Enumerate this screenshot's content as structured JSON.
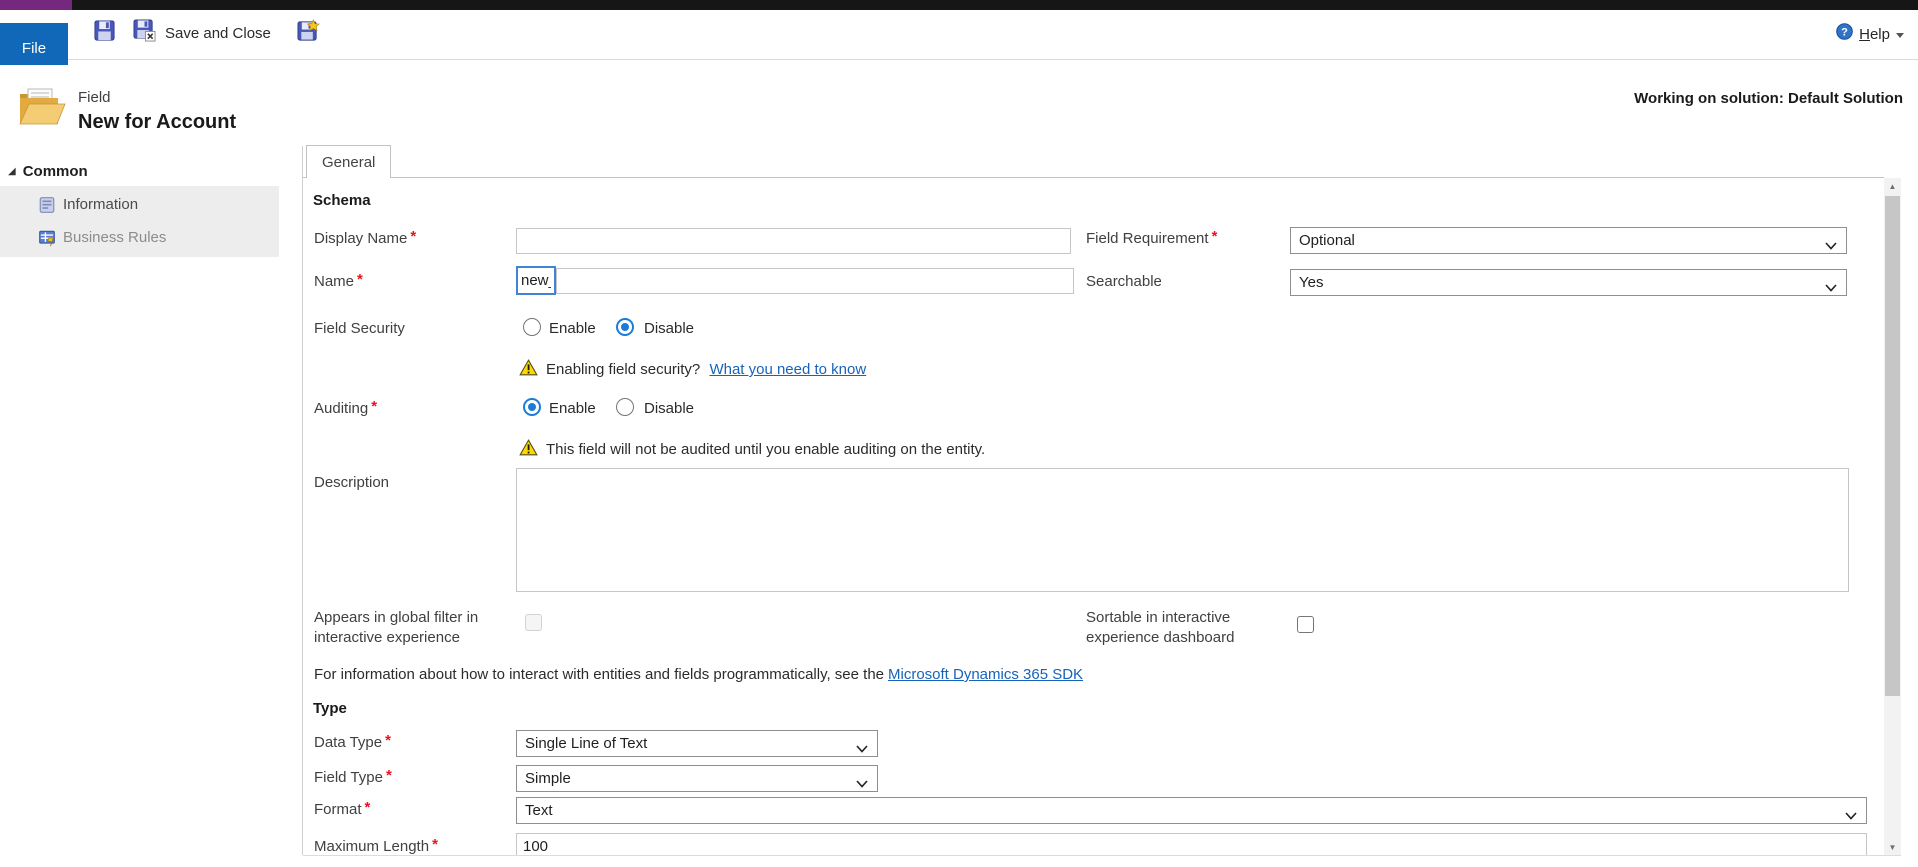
{
  "topbar": {
    "file_label": "File",
    "save_and_close_label": "Save and Close",
    "help_key": "H",
    "help_rest": "elp"
  },
  "header": {
    "record_type": "Field",
    "title": "New for Account",
    "solution_note": "Working on solution: Default Solution"
  },
  "sidebar": {
    "expander_glyph": "◢",
    "group_label": "Common",
    "items": [
      {
        "label": "Information"
      },
      {
        "label": "Business Rules"
      }
    ]
  },
  "tabs": {
    "general_label": "General"
  },
  "form": {
    "required_marker": "*",
    "schema_heading": "Schema",
    "display_name_label": "Display Name",
    "display_name_value": "",
    "field_requirement_label": "Field Requirement",
    "field_requirement_value": "Optional",
    "name_label": "Name",
    "name_prefix_value": "new_",
    "name_value": "",
    "searchable_label": "Searchable",
    "searchable_value": "Yes",
    "field_security_label": "Field Security",
    "enable_label": "Enable",
    "disable_label": "Disable",
    "field_security_selected": "Disable",
    "field_security_warning_text": "Enabling field security?",
    "field_security_warning_link": "What you need to know",
    "auditing_label": "Auditing",
    "auditing_selected": "Enable",
    "auditing_warning_text": "This field will not be audited until you enable auditing on the entity.",
    "description_label": "Description",
    "description_value": "",
    "global_filter_label_line1": "Appears in global filter in",
    "global_filter_label_line2": "interactive experience",
    "global_filter_checked": false,
    "sortable_label_line1": "Sortable in interactive",
    "sortable_label_line2": "experience dashboard",
    "sortable_checked": false,
    "sdk_text": "For information about how to interact with entities and fields programmatically, see the",
    "sdk_link_label": "Microsoft Dynamics 365 SDK",
    "type_heading": "Type",
    "data_type_label": "Data Type",
    "data_type_value": "Single Line of Text",
    "field_type_label": "Field Type",
    "field_type_value": "Simple",
    "format_label": "Format",
    "format_value": "Text",
    "max_length_label": "Maximum Length",
    "max_length_value": "100"
  },
  "scrollbar": {
    "up_glyph": "▲",
    "down_glyph": "▼"
  },
  "colors": {
    "accent_blue": "#1168b8",
    "top_strip_purple": "#76287e",
    "link_blue": "#1763bb",
    "radio_selected_blue": "#1a7cd9",
    "warning_yellow": "#ffd800",
    "required_red": "#e8111d"
  }
}
